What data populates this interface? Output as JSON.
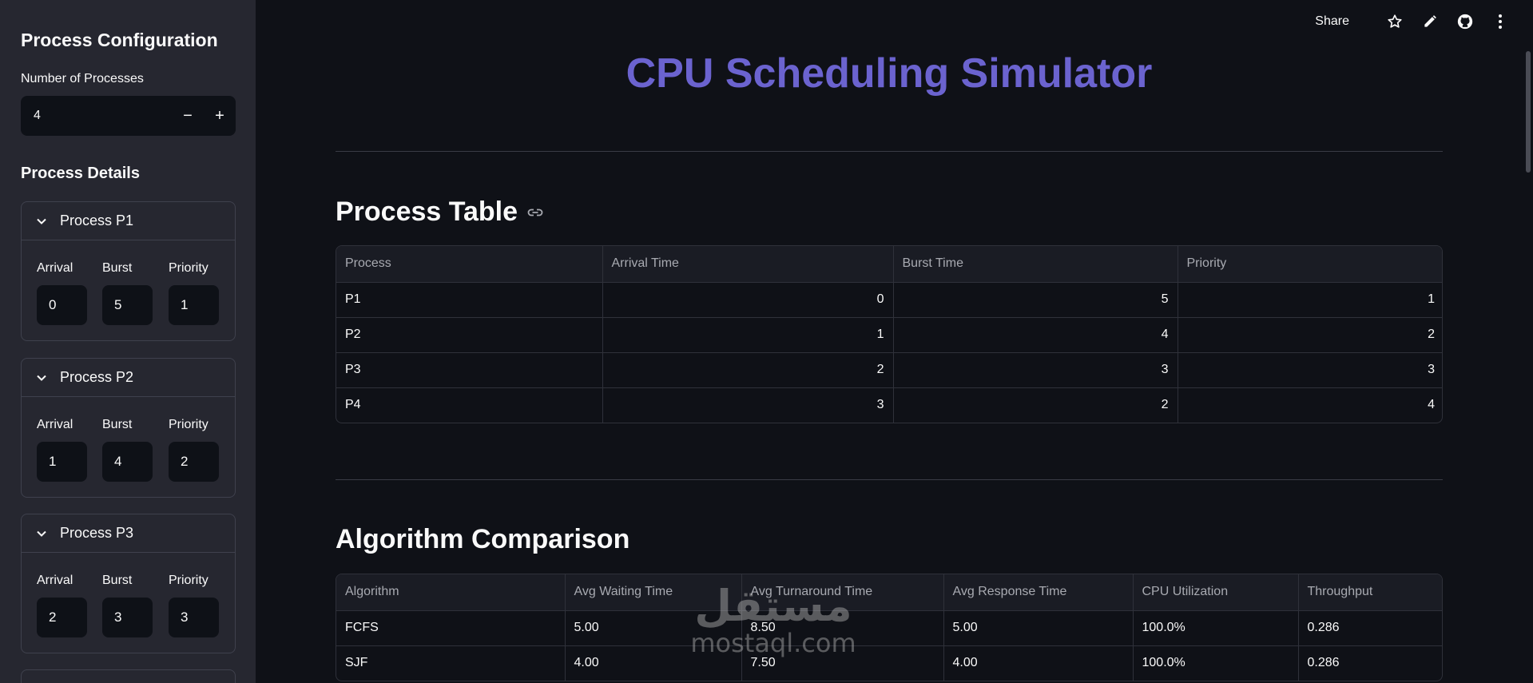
{
  "sidebar": {
    "title": "Process Configuration",
    "num_processes_label": "Number of Processes",
    "num_processes_value": "4",
    "minus": "−",
    "plus": "+",
    "details_title": "Process Details",
    "field_labels": {
      "arrival": "Arrival",
      "burst": "Burst",
      "priority": "Priority"
    },
    "processes": [
      {
        "title": "Process P1",
        "arrival": "0",
        "burst": "5",
        "priority": "1"
      },
      {
        "title": "Process P2",
        "arrival": "1",
        "burst": "4",
        "priority": "2"
      },
      {
        "title": "Process P3",
        "arrival": "2",
        "burst": "3",
        "priority": "3"
      }
    ]
  },
  "topbar": {
    "share_label": "Share",
    "icons": [
      "star-icon",
      "pencil-icon",
      "github-icon",
      "more-vert-icon"
    ]
  },
  "main": {
    "title": "CPU Scheduling Simulator",
    "title_color": "#6b63cf",
    "process_table": {
      "heading": "Process Table",
      "columns": [
        "Process",
        "Arrival Time",
        "Burst Time",
        "Priority"
      ],
      "rows": [
        [
          "P1",
          "0",
          "5",
          "1"
        ],
        [
          "P2",
          "1",
          "4",
          "2"
        ],
        [
          "P3",
          "2",
          "3",
          "3"
        ],
        [
          "P4",
          "3",
          "2",
          "4"
        ]
      ]
    },
    "comparison": {
      "heading": "Algorithm Comparison",
      "columns": [
        "Algorithm",
        "Avg Waiting Time",
        "Avg Turnaround Time",
        "Avg Response Time",
        "CPU Utilization",
        "Throughput"
      ],
      "rows": [
        [
          "FCFS",
          "5.00",
          "8.50",
          "5.00",
          "100.0%",
          "0.286"
        ],
        [
          "SJF",
          "4.00",
          "7.50",
          "4.00",
          "100.0%",
          "0.286"
        ]
      ]
    }
  },
  "watermark": {
    "logo_text": "مستقل",
    "site_text": "mostaql.com"
  }
}
